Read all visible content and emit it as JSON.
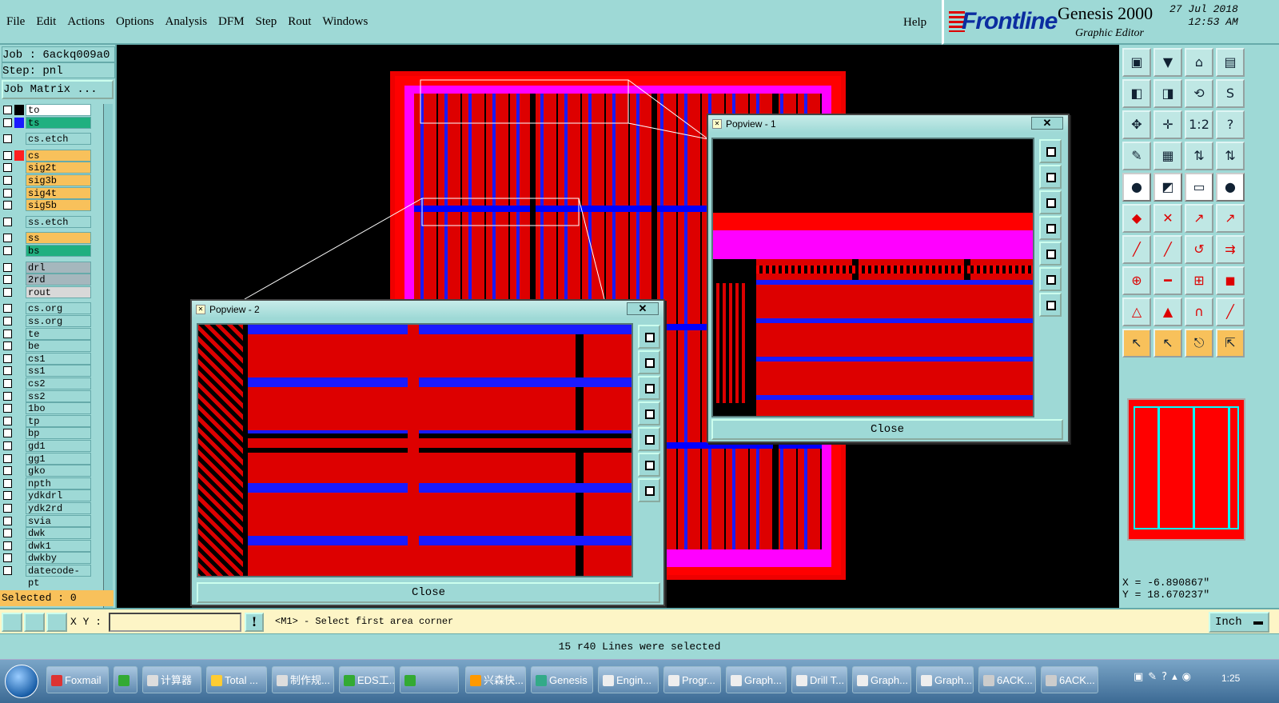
{
  "menubar": {
    "items": [
      "File",
      "Edit",
      "Actions",
      "Options",
      "Analysis",
      "DFM",
      "Step",
      "Rout",
      "Windows"
    ],
    "help": "Help"
  },
  "brand": {
    "logo": "Frontline",
    "product": "Genesis 2000",
    "subtitle": "Graphic Editor",
    "date": "27 Jul 2018",
    "time": "12:53 AM"
  },
  "left": {
    "job": "Job : 6ackq009a0",
    "step": "Step: pnl",
    "job_matrix": "Job Matrix ...",
    "selected": "Selected : 0",
    "layers": [
      {
        "name": "to",
        "swatch": "#000",
        "bg": "#ffffff"
      },
      {
        "name": "ts",
        "swatch": "#1a1aff",
        "bg": "#20b080"
      },
      {
        "name": "cs.etch",
        "swatch": "",
        "bg": "#9ed9d6"
      },
      {
        "name": "cs",
        "swatch": "#ff2020",
        "bg": "#f8c15b"
      },
      {
        "name": "sig2t",
        "swatch": "",
        "bg": "#f8c15b"
      },
      {
        "name": "sig3b",
        "swatch": "",
        "bg": "#f8c15b"
      },
      {
        "name": "sig4t",
        "swatch": "",
        "bg": "#f8c15b"
      },
      {
        "name": "sig5b",
        "swatch": "",
        "bg": "#f8c15b"
      },
      {
        "name": "ss.etch",
        "swatch": "",
        "bg": "#9ed9d6"
      },
      {
        "name": "ss",
        "swatch": "",
        "bg": "#f8c15b"
      },
      {
        "name": "bs",
        "swatch": "",
        "bg": "#20b080"
      },
      {
        "name": "drl",
        "swatch": "",
        "bg": "#a5b7bd"
      },
      {
        "name": "2rd",
        "swatch": "",
        "bg": "#a5b7bd"
      },
      {
        "name": "rout",
        "swatch": "",
        "bg": "#d8d8d8"
      },
      {
        "name": "cs.org",
        "swatch": "",
        "bg": "#9ed9d6"
      },
      {
        "name": "ss.org",
        "swatch": "",
        "bg": "#9ed9d6"
      },
      {
        "name": "te",
        "swatch": "",
        "bg": "#9ed9d6"
      },
      {
        "name": "be",
        "swatch": "",
        "bg": "#9ed9d6"
      },
      {
        "name": "cs1",
        "swatch": "",
        "bg": "#9ed9d6"
      },
      {
        "name": "ss1",
        "swatch": "",
        "bg": "#9ed9d6"
      },
      {
        "name": "cs2",
        "swatch": "",
        "bg": "#9ed9d6"
      },
      {
        "name": "ss2",
        "swatch": "",
        "bg": "#9ed9d6"
      },
      {
        "name": "1bo",
        "swatch": "",
        "bg": "#9ed9d6"
      },
      {
        "name": "tp",
        "swatch": "",
        "bg": "#9ed9d6"
      },
      {
        "name": "bp",
        "swatch": "",
        "bg": "#9ed9d6"
      },
      {
        "name": "gd1",
        "swatch": "",
        "bg": "#9ed9d6"
      },
      {
        "name": "gg1",
        "swatch": "",
        "bg": "#9ed9d6"
      },
      {
        "name": "gko",
        "swatch": "",
        "bg": "#9ed9d6"
      },
      {
        "name": "npth",
        "swatch": "",
        "bg": "#9ed9d6"
      },
      {
        "name": "ydkdrl",
        "swatch": "",
        "bg": "#9ed9d6"
      },
      {
        "name": "ydk2rd",
        "swatch": "",
        "bg": "#9ed9d6"
      },
      {
        "name": "svia",
        "swatch": "",
        "bg": "#9ed9d6"
      },
      {
        "name": "dwk",
        "swatch": "",
        "bg": "#9ed9d6"
      },
      {
        "name": "dwk1",
        "swatch": "",
        "bg": "#9ed9d6"
      },
      {
        "name": "dwkby",
        "swatch": "",
        "bg": "#9ed9d6"
      },
      {
        "name": "datecode-pt",
        "swatch": "",
        "bg": "#9ed9d6"
      }
    ]
  },
  "popview1": {
    "title": "Popview - 1",
    "close": "Close"
  },
  "popview2": {
    "title": "Popview - 2",
    "close": "Close"
  },
  "right": {
    "coord_x": "X = -6.890867\"",
    "coord_y": "Y = 18.670237\""
  },
  "command": {
    "xy_label": "X Y :",
    "xy_value": "",
    "warn": "!",
    "prompt": "<M1> - Select first area corner",
    "units": "Inch"
  },
  "status": "15 r40 Lines were selected",
  "taskbar": {
    "items": [
      {
        "label": "Foxmail",
        "color": "#d33"
      },
      {
        "label": "",
        "color": "#3a3"
      },
      {
        "label": "计算器",
        "color": "#ddd"
      },
      {
        "label": "Total ...",
        "color": "#fc3"
      },
      {
        "label": "制作规...",
        "color": "#ddd"
      },
      {
        "label": "EDS工...",
        "color": "#3a3"
      },
      {
        "label": "",
        "color": "#3a3"
      },
      {
        "label": "兴森快...",
        "color": "#f90"
      },
      {
        "label": "Genesis",
        "color": "#3a8"
      },
      {
        "label": "Engin...",
        "color": "#eee"
      },
      {
        "label": "Progr...",
        "color": "#eee"
      },
      {
        "label": "Graph...",
        "color": "#eee"
      },
      {
        "label": "Drill T...",
        "color": "#eee"
      },
      {
        "label": "Graph...",
        "color": "#eee"
      },
      {
        "label": "Graph...",
        "color": "#eee"
      },
      {
        "label": "6ACK...",
        "color": "#ccc"
      },
      {
        "label": "6ACK...",
        "color": "#ccc"
      }
    ],
    "clock": "1:25"
  }
}
